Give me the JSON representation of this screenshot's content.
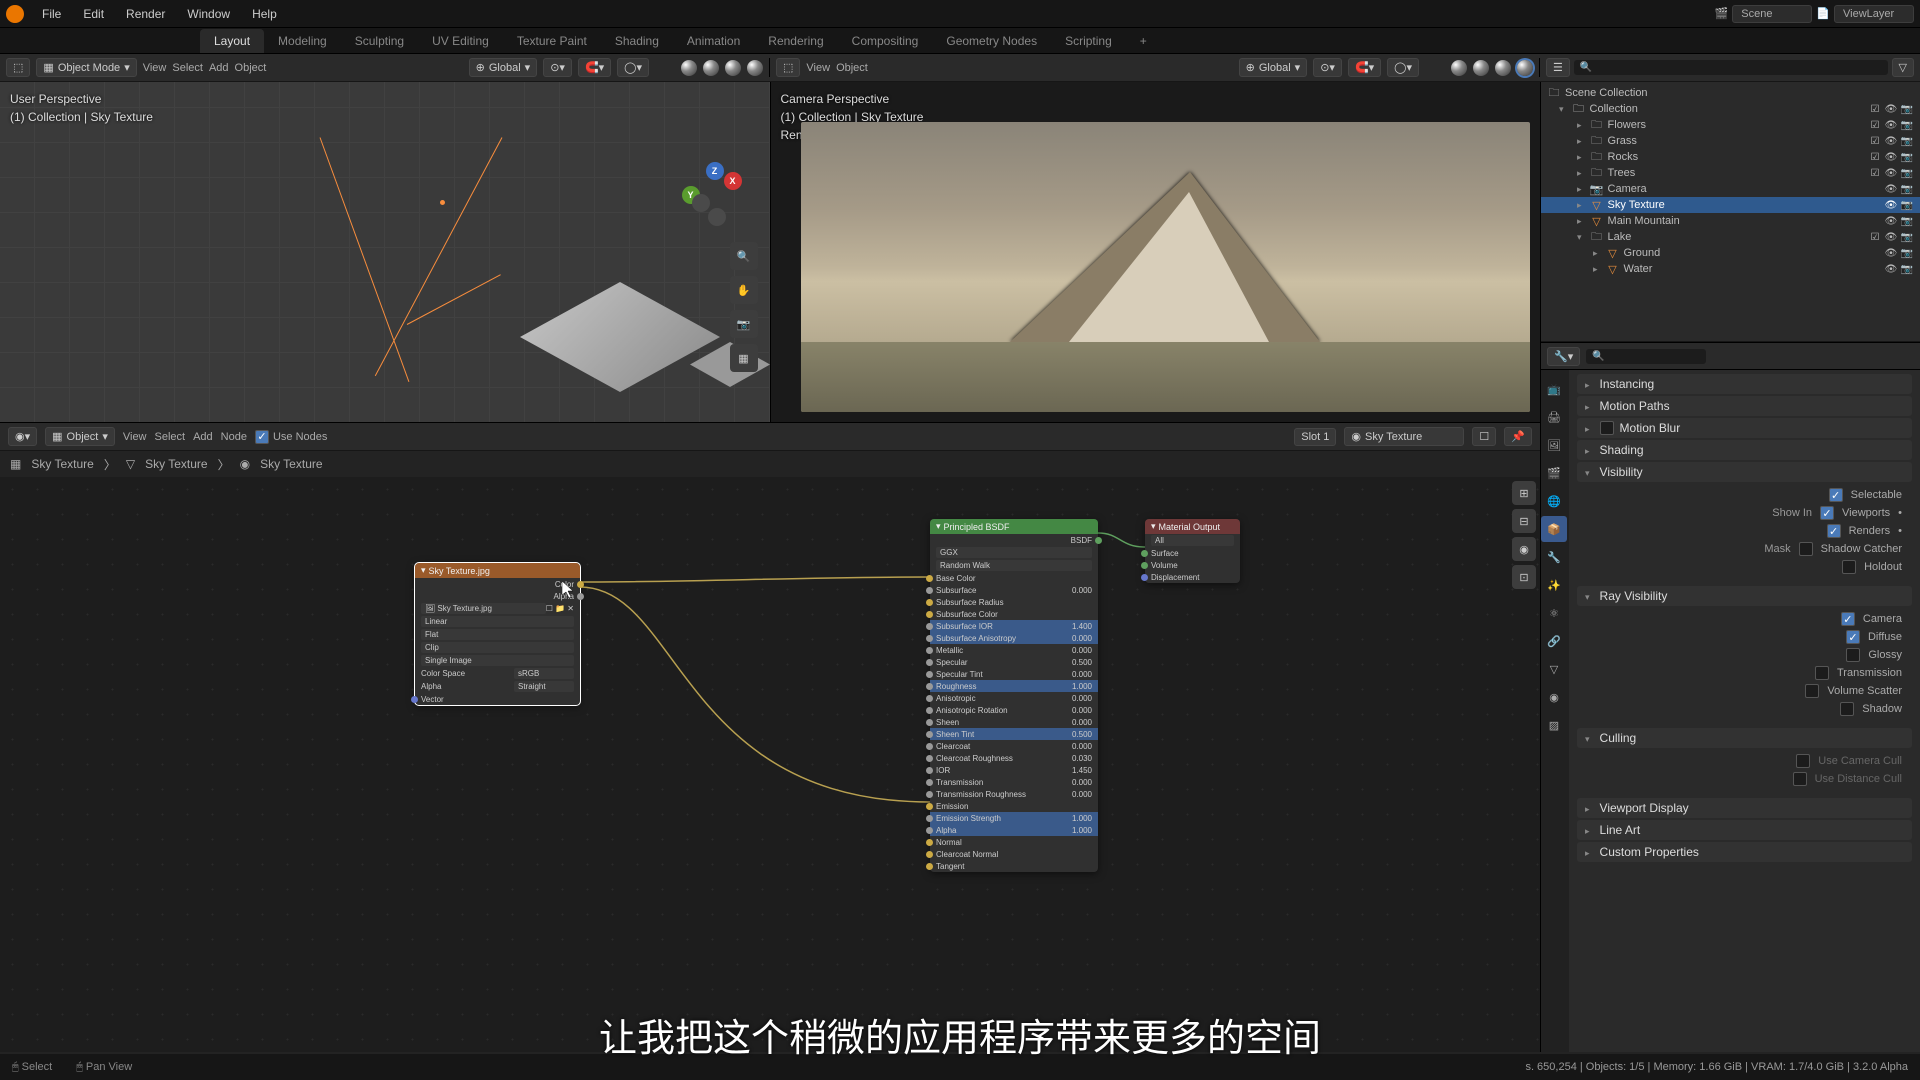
{
  "top_menu": {
    "file": "File",
    "edit": "Edit",
    "render": "Render",
    "window": "Window",
    "help": "Help"
  },
  "scene_bar": {
    "scene": "Scene",
    "viewlayer": "ViewLayer"
  },
  "workspace_tabs": [
    "Layout",
    "Modeling",
    "Sculpting",
    "UV Editing",
    "Texture Paint",
    "Shading",
    "Animation",
    "Rendering",
    "Compositing",
    "Geometry Nodes",
    "Scripting"
  ],
  "toolbar3d": {
    "mode": "Object Mode",
    "view": "View",
    "select": "Select",
    "add": "Add",
    "object": "Object",
    "orient": "Global"
  },
  "viewport_a": {
    "title": "User Perspective",
    "sub": "(1) Collection | Sky Texture"
  },
  "viewport_b": {
    "title": "Camera Perspective",
    "sub": "(1) Collection | Sky Texture",
    "status": "Rendering Done"
  },
  "node_header": {
    "object": "Object",
    "view": "View",
    "select": "Select",
    "add": "Add",
    "node": "Node",
    "use_nodes": "Use Nodes",
    "slot": "Slot 1",
    "material": "Sky Texture"
  },
  "breadcrumb": [
    "Sky Texture",
    "Sky Texture",
    "Sky Texture"
  ],
  "node_img": {
    "title": "Sky Texture.jpg",
    "out_color": "Color",
    "out_alpha": "Alpha",
    "file": "Sky Texture.jpg",
    "interp": "Linear",
    "proj": "Flat",
    "ext": "Clip",
    "single": "Single Image",
    "cs_label": "Color Space",
    "cs_val": "sRGB",
    "alpha_label": "Alpha",
    "alpha_val": "Straight",
    "vector": "Vector"
  },
  "node_bsdf": {
    "title": "Principled BSDF",
    "out": "BSDF",
    "dist": "GGX",
    "sss_method": "Random Walk",
    "rows": [
      {
        "l": "Base Color",
        "v": ""
      },
      {
        "l": "Subsurface",
        "v": "0.000"
      },
      {
        "l": "Subsurface Radius",
        "v": ""
      },
      {
        "l": "Subsurface Color",
        "v": ""
      },
      {
        "l": "Subsurface IOR",
        "v": "1.400",
        "hl": true
      },
      {
        "l": "Subsurface Anisotropy",
        "v": "0.000",
        "hl": true
      },
      {
        "l": "Metallic",
        "v": "0.000"
      },
      {
        "l": "Specular",
        "v": "0.500"
      },
      {
        "l": "Specular Tint",
        "v": "0.000"
      },
      {
        "l": "Roughness",
        "v": "1.000",
        "hl": true
      },
      {
        "l": "Anisotropic",
        "v": "0.000"
      },
      {
        "l": "Anisotropic Rotation",
        "v": "0.000"
      },
      {
        "l": "Sheen",
        "v": "0.000"
      },
      {
        "l": "Sheen Tint",
        "v": "0.500",
        "hl": true
      },
      {
        "l": "Clearcoat",
        "v": "0.000"
      },
      {
        "l": "Clearcoat Roughness",
        "v": "0.030"
      },
      {
        "l": "IOR",
        "v": "1.450"
      },
      {
        "l": "Transmission",
        "v": "0.000"
      },
      {
        "l": "Transmission Roughness",
        "v": "0.000"
      },
      {
        "l": "Emission",
        "v": ""
      },
      {
        "l": "Emission Strength",
        "v": "1.000",
        "hl": true
      },
      {
        "l": "Alpha",
        "v": "1.000",
        "hl": true
      },
      {
        "l": "Normal",
        "v": ""
      },
      {
        "l": "Clearcoat Normal",
        "v": ""
      },
      {
        "l": "Tangent",
        "v": ""
      }
    ]
  },
  "node_out": {
    "title": "Material Output",
    "target": "All",
    "surface": "Surface",
    "volume": "Volume",
    "disp": "Displacement"
  },
  "outliner": {
    "root": "Scene Collection",
    "collection": "Collection",
    "items": [
      {
        "name": "Flowers",
        "type": "coll"
      },
      {
        "name": "Grass",
        "type": "coll"
      },
      {
        "name": "Rocks",
        "type": "coll"
      },
      {
        "name": "Trees",
        "type": "coll"
      },
      {
        "name": "Camera",
        "type": "cam"
      },
      {
        "name": "Sky Texture",
        "type": "mesh",
        "sel": true
      },
      {
        "name": "Main Mountain",
        "type": "mesh"
      },
      {
        "name": "Lake",
        "type": "coll",
        "open": true
      },
      {
        "name": "Ground",
        "type": "mesh",
        "indent": 1
      },
      {
        "name": "Water",
        "type": "mesh",
        "indent": 1
      }
    ]
  },
  "properties": {
    "search_hint": "",
    "instancing": "Instancing",
    "motion_paths": "Motion Paths",
    "motion_blur": "Motion Blur",
    "shading": "Shading",
    "visibility": "Visibility",
    "selectable": "Selectable",
    "show_in": "Show In",
    "viewports": "Viewports",
    "renders": "Renders",
    "mask": "Mask",
    "shadow_catcher": "Shadow Catcher",
    "holdout": "Holdout",
    "ray_vis": "Ray Visibility",
    "camera": "Camera",
    "diffuse": "Diffuse",
    "glossy": "Glossy",
    "transmission": "Transmission",
    "volume_scatter": "Volume Scatter",
    "shadow": "Shadow",
    "culling": "Culling",
    "use_cam_cull": "Use Camera Cull",
    "use_dist_cull": "Use Distance Cull",
    "viewport_display": "Viewport Display",
    "line_art": "Line Art",
    "custom_props": "Custom Properties"
  },
  "status": {
    "select": "Select",
    "pan": "Pan View",
    "right": "s. 650,254 | Objects: 1/5 | Memory: 1.66 GiB | VRAM: 1.7/4.0 GiB | 3.2.0 Alpha"
  },
  "subtitle": "让我把这个稍微的应用程序带来更多的空间"
}
